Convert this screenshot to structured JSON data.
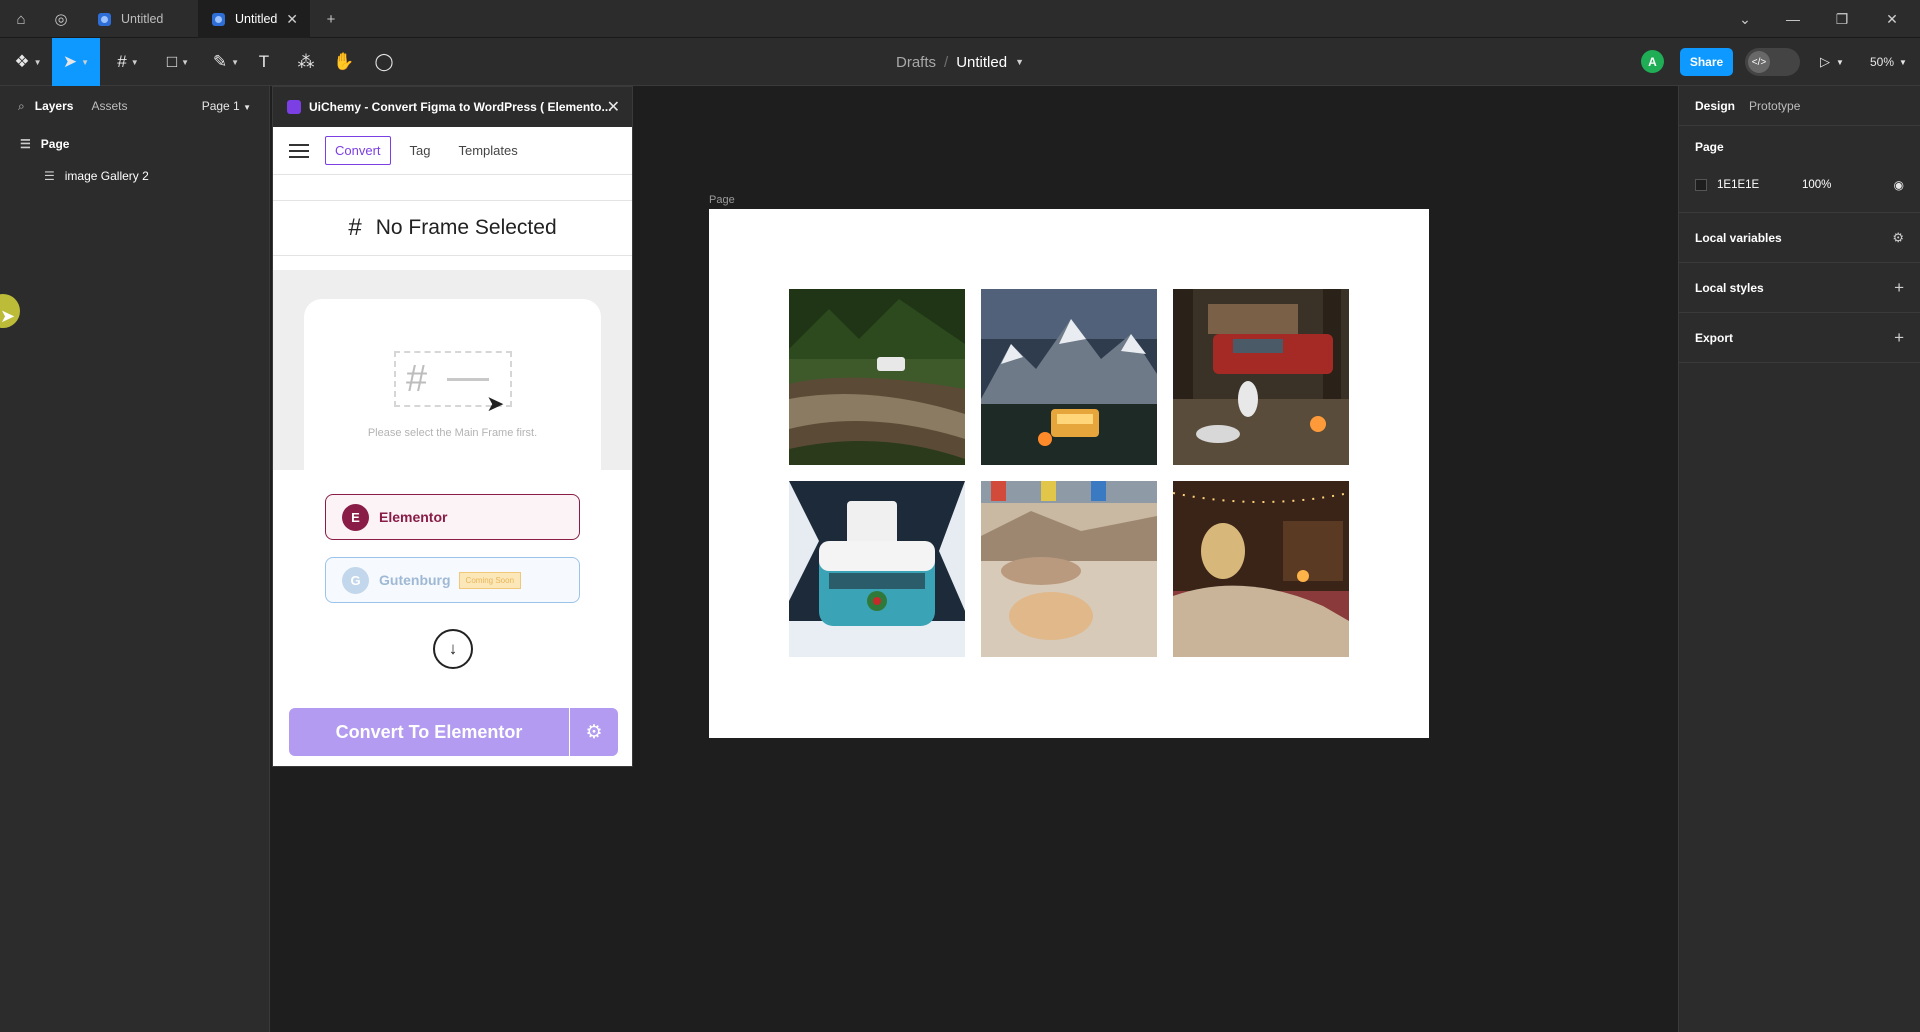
{
  "window": {
    "tabs": [
      {
        "label": "Untitled",
        "active": false
      },
      {
        "label": "Untitled",
        "active": true
      }
    ],
    "new_tab_label": "+"
  },
  "toolbar": {
    "breadcrumb_parent": "Drafts",
    "breadcrumb_current": "Untitled",
    "avatar_initial": "A",
    "share_label": "Share",
    "zoom_label": "50%"
  },
  "layers_panel": {
    "tab_layers": "Layers",
    "tab_assets": "Assets",
    "page_selector": "Page 1",
    "items": [
      {
        "label": "Page"
      },
      {
        "label": "image Gallery 2"
      }
    ]
  },
  "plugin": {
    "title": "UiChemy - Convert Figma to WordPress ( Elemento...",
    "tabs": [
      "Convert",
      "Tag",
      "Templates"
    ],
    "active_tab": "Convert",
    "status": "No Frame Selected",
    "hint": "Please select the Main Frame first.",
    "elementor_label": "Elementor",
    "gutenburg_label": "Gutenburg",
    "coming_soon_label": "Coming Soon",
    "convert_button": "Convert To Elementor"
  },
  "canvas": {
    "frame_label": "Page",
    "frame_fill": "#ffffff",
    "photos": [
      "forest-river-van",
      "mountain-campfire-van",
      "red-car-dogs-camp",
      "snowy-vw-bus",
      "dog-sleeping-blanket",
      "woman-inside-van"
    ]
  },
  "design_panel": {
    "tab_design": "Design",
    "tab_prototype": "Prototype",
    "page_section": "Page",
    "page_fill_hex": "1E1E1E",
    "page_fill_opacity": "100%",
    "local_variables": "Local variables",
    "local_styles": "Local styles",
    "export": "Export"
  },
  "colors": {
    "accent": "#0d99ff",
    "plugin_accent": "#7b3fe4",
    "elementor": "#8a1d47"
  },
  "help_label": "?"
}
